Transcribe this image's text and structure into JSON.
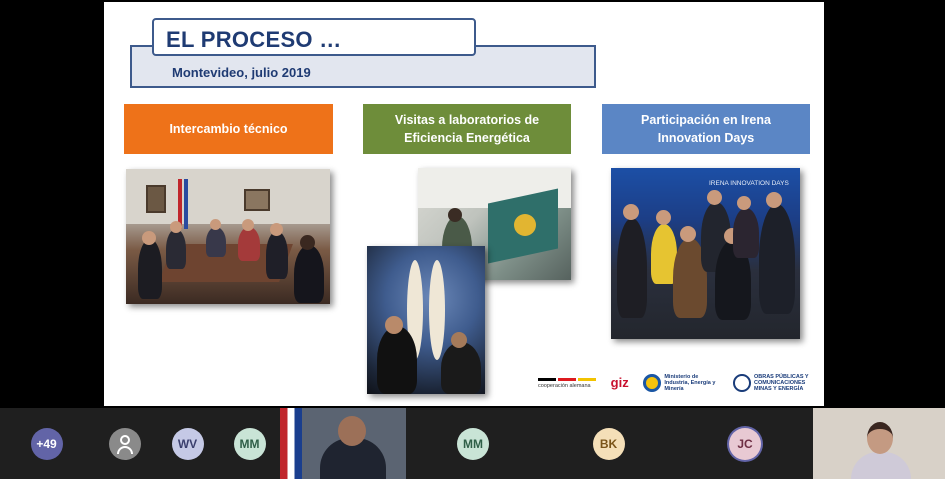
{
  "slide": {
    "title": "EL PROCESO …",
    "subtitle": "Montevideo, julio 2019",
    "categories": [
      {
        "label": "Intercambio técnico"
      },
      {
        "label": "Visitas a laboratorios de Eficiencia Energética"
      },
      {
        "label": "Participación en Irena Innovation Days"
      }
    ],
    "photo_banner_text": "IRENA INNOVATION DAYS",
    "logos": {
      "cooperacion": "cooperación alemana",
      "giz": "giz",
      "ministerio_uy": "Ministerio de Industria, Energía y Minería",
      "ministerio_py": "OBRAS PÚBLICAS Y COMUNICACIONES",
      "ministerio_py_sub": "MINAS Y ENERGÍA"
    }
  },
  "participants": [
    {
      "label": "+49",
      "bg": "#6264a7",
      "fg": "#ffffff"
    },
    {
      "label": "",
      "icon": "person-icon",
      "bg": "#8a8a8a",
      "fg": "#ffffff"
    },
    {
      "label": "WV",
      "bg": "#c5c9e6",
      "fg": "#3b3f6e"
    },
    {
      "label": "MM",
      "bg": "#c9e4d6",
      "fg": "#2f5f48"
    },
    {
      "label": "",
      "video": true
    },
    {
      "label": "MM",
      "bg": "#c9e4d6",
      "fg": "#2f5f48"
    },
    {
      "label": "BK",
      "bg": "#f4dfb8",
      "fg": "#7a5418"
    },
    {
      "label": "JC",
      "bg": "#e8c9d3",
      "fg": "#6e2f44"
    },
    {
      "label": "",
      "video": true
    }
  ],
  "colors": {
    "orange": "#ee7219",
    "olive": "#6e8d3a",
    "blue": "#5b86c5",
    "title_navy": "#1f3b73"
  }
}
